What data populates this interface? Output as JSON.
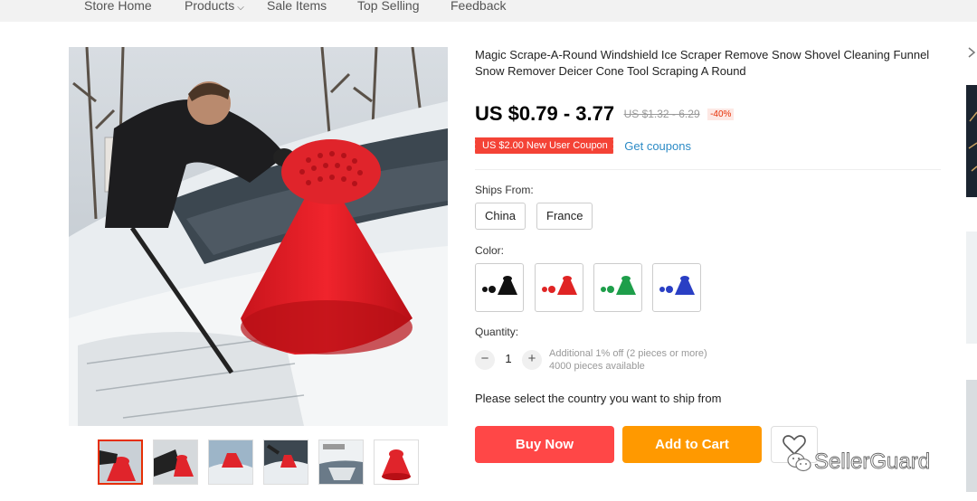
{
  "nav": {
    "items": [
      {
        "label": "Store Home"
      },
      {
        "label": "Products",
        "has_dropdown": true
      },
      {
        "label": "Sale Items"
      },
      {
        "label": "Top Selling"
      },
      {
        "label": "Feedback"
      }
    ]
  },
  "product": {
    "title": "Magic Scrape-A-Round Windshield Ice Scraper Remove Snow Shovel Cleaning Funnel Snow Remover Deicer Cone Tool Scraping A Round",
    "price": "US $0.79 - 3.77",
    "original_price": "US $1.32 - 6.29",
    "discount": "-40%",
    "coupon": "US $2.00 New User Coupon",
    "get_coupons": "Get coupons"
  },
  "ships_from": {
    "label": "Ships From:",
    "options": [
      "China",
      "France"
    ]
  },
  "color": {
    "label": "Color:",
    "options": [
      {
        "icon": "black-scraper-icon",
        "color": "#111111"
      },
      {
        "icon": "red-scraper-icon",
        "color": "#e02424"
      },
      {
        "icon": "green-scraper-icon",
        "color": "#1e9e4a"
      },
      {
        "icon": "blue-scraper-icon",
        "color": "#2a3fc4"
      }
    ]
  },
  "quantity": {
    "label": "Quantity:",
    "minus": "−",
    "value": "1",
    "plus": "+",
    "note_line1": "Additional 1% off (2 pieces or more)",
    "note_line2": "4000 pieces available"
  },
  "shipping_message": "Please select the country you want to ship from",
  "actions": {
    "buy_now": "Buy Now",
    "add_to_cart": "Add to Cart",
    "wishlist_icon": "heart-icon"
  },
  "colors": {
    "accent_red": "#ff4747",
    "accent_orange": "#ff9900",
    "link_blue": "#2c8bc6"
  }
}
